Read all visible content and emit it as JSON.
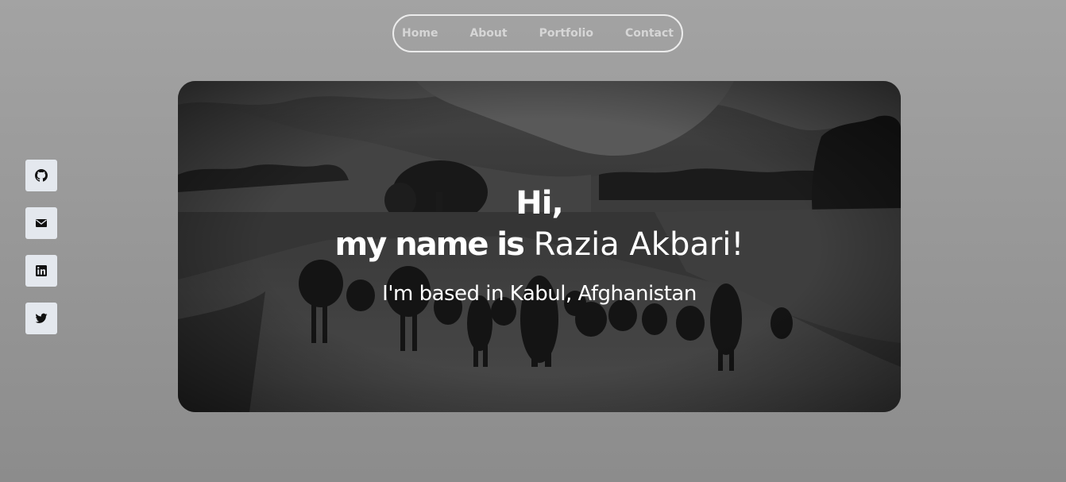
{
  "nav": {
    "items": [
      {
        "label": "Home"
      },
      {
        "label": "About"
      },
      {
        "label": "Portfolio"
      },
      {
        "label": "Contact"
      }
    ]
  },
  "social": {
    "items": [
      {
        "icon": "github-icon"
      },
      {
        "icon": "mail-icon"
      },
      {
        "icon": "linkedin-icon"
      },
      {
        "icon": "twitter-icon"
      }
    ]
  },
  "hero": {
    "greeting_line1": "Hi,",
    "greeting_lead": "my name is",
    "name": "Razia Akbari!",
    "location": "I'm based in Kabul, Afghanistan"
  },
  "colors": {
    "background": "#9a9a9a",
    "nav_border": "#ececec",
    "nav_text": "#d6d6d6",
    "social_bg": "#e4e8ee",
    "hero_text": "#ffffff"
  }
}
